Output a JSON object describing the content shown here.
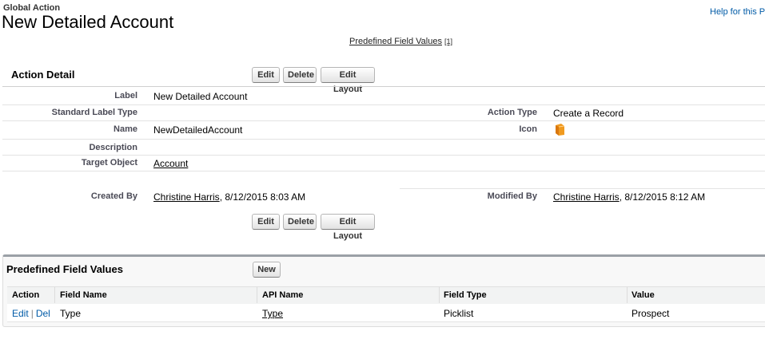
{
  "header": {
    "type_label": "Global Action",
    "title": "New Detailed Account",
    "help_link": "Help for this P",
    "predefined_link": "Predefined Field Values",
    "predefined_count": "[1]"
  },
  "detail": {
    "section_title": "Action Detail",
    "buttons": {
      "edit": "Edit",
      "delete": "Delete",
      "edit_layout": "Edit Layout"
    },
    "fields": {
      "label_label": "Label",
      "label_value": "New Detailed Account",
      "standard_label_type_label": "Standard Label Type",
      "standard_label_type_value": "",
      "action_type_label": "Action Type",
      "action_type_value": "Create a Record",
      "name_label": "Name",
      "name_value": "NewDetailedAccount",
      "icon_label": "Icon",
      "icon_name": "orange-book-icon",
      "description_label": "Description",
      "description_value": "",
      "target_object_label": "Target Object",
      "target_object_value": "Account",
      "created_by_label": "Created By",
      "created_by_user": "Christine Harris",
      "created_by_date": ", 8/12/2015 8:03 AM",
      "modified_by_label": "Modified By",
      "modified_by_user": "Christine Harris",
      "modified_by_date": ", 8/12/2015 8:12 AM"
    }
  },
  "related_list": {
    "title": "Predefined Field Values",
    "new_button": "New",
    "columns": [
      "Action",
      "Field Name",
      "API Name",
      "Field Type",
      "Value"
    ],
    "rows": [
      {
        "edit": "Edit",
        "sep": "|",
        "del": "Del",
        "field_name": "Type",
        "api_name": "Type",
        "field_type": "Picklist",
        "value": "Prospect"
      }
    ]
  },
  "colors": {
    "link_blue": "#015ba7",
    "icon_orange": "#f09a1f",
    "tab_border": "#9aa0a6"
  }
}
